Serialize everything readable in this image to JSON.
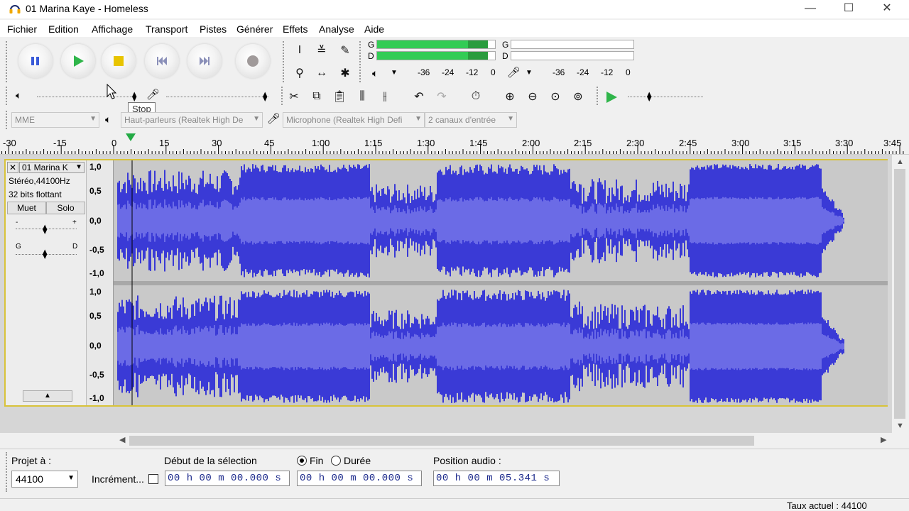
{
  "window": {
    "title": "01 Marina Kaye - Homeless",
    "minimize": "—",
    "maximize": "☐",
    "close": "✕"
  },
  "menu": [
    "Fichier",
    "Edition",
    "Affichage",
    "Transport",
    "Pistes",
    "Générer",
    "Effets",
    "Analyse",
    "Aide"
  ],
  "tooltip": "Stop",
  "meters": {
    "play_left": "G",
    "play_right": "D",
    "rec_left": "G",
    "rec_right": "D",
    "scale": [
      "-36",
      "-24",
      "-12",
      "0"
    ]
  },
  "device": {
    "host": "MME",
    "output": "Haut-parleurs (Realtek High De",
    "input": "Microphone (Realtek High Defi",
    "channels": "2 canaux d'entrée"
  },
  "ruler": [
    "-30",
    "-15",
    "0",
    "15",
    "30",
    "45",
    "1:00",
    "1:15",
    "1:30",
    "1:45",
    "2:00",
    "2:15",
    "2:30",
    "2:45",
    "3:00",
    "3:15",
    "3:30",
    "3:45"
  ],
  "track": {
    "name": "01 Marina K",
    "format": "Stéréo,44100Hz",
    "bits": "32 bits flottant",
    "mute": "Muet",
    "solo": "Solo",
    "gain_minus": "-",
    "gain_plus": "+",
    "pan_left": "G",
    "pan_right": "D",
    "vscale": [
      "1,0",
      "0,5",
      "0,0",
      "-0,5",
      "-1,0"
    ]
  },
  "selection_bar": {
    "project_rate_label": "Projet à :",
    "project_rate": "44100",
    "snap_label": "Incrément...",
    "sel_start_label": "Début de la sélection",
    "end_label": "Fin",
    "length_label": "Durée",
    "audio_pos_label": "Position audio :",
    "start_time": "00 h 00 m 00.000 s",
    "end_time": "00 h 00 m 00.000 s",
    "audio_time": "00 h 00 m 05.341 s",
    "end_selected": true
  },
  "status": "Taux actuel : 44100",
  "colors": {
    "waveform": "#3a3ad6",
    "waveform_rms": "#6b6be6",
    "selection_border": "#d8c33a",
    "meter_green": "#33cc55"
  }
}
